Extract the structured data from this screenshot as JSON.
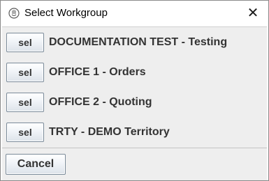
{
  "window": {
    "title": "Select Workgroup",
    "app_icon": "java-cup-icon",
    "close_glyph": "✕"
  },
  "workgroups": [
    {
      "button_label": "sel",
      "name": "DOCUMENTATION TEST - Testing"
    },
    {
      "button_label": "sel",
      "name": "OFFICE 1 - Orders"
    },
    {
      "button_label": "sel",
      "name": "OFFICE 2 - Quoting"
    },
    {
      "button_label": "sel",
      "name": "TRTY - DEMO Territory"
    }
  ],
  "footer": {
    "cancel_label": "Cancel"
  },
  "colors": {
    "panel_bg": "#eeeeee",
    "text": "#333333",
    "button_border": "#7a8a99"
  }
}
